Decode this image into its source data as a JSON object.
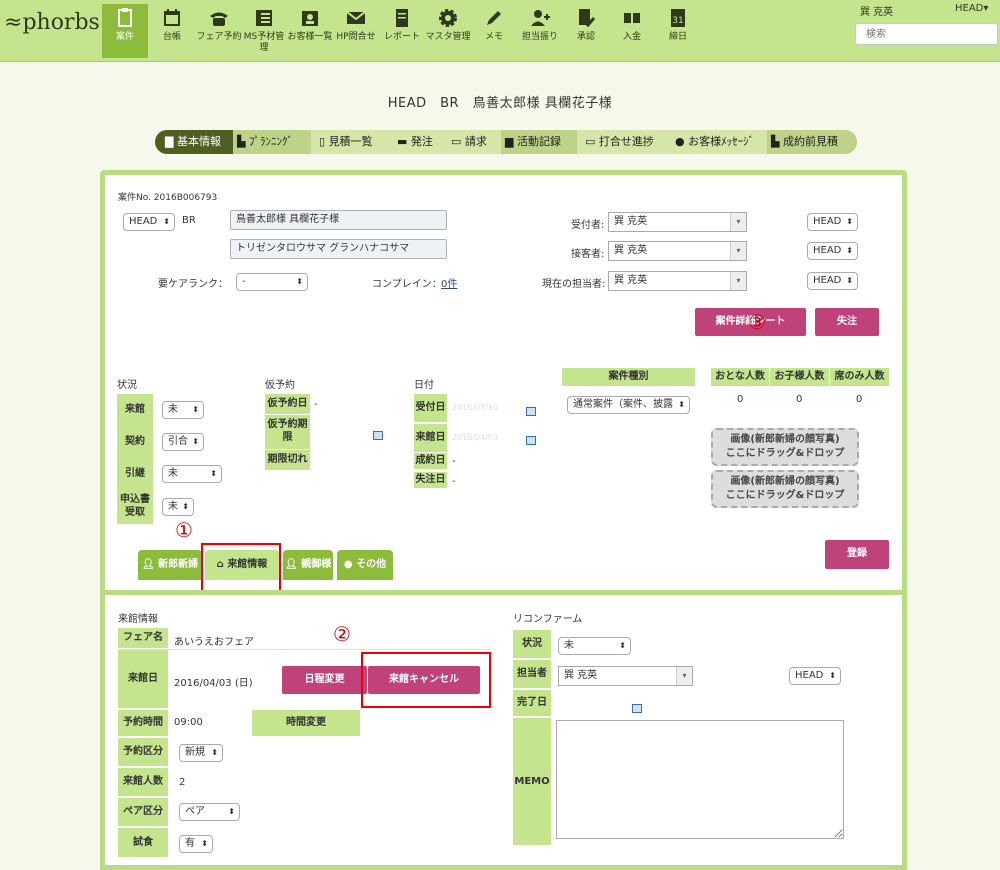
{
  "nav": {
    "logo": "phorbs",
    "items": [
      {
        "label": "案件",
        "icon": "clipboard-icon",
        "active": true
      },
      {
        "label": "台帳",
        "icon": "calendar-icon"
      },
      {
        "label": "フェア予約",
        "icon": "phone-icon"
      },
      {
        "label": "MS予材管理",
        "icon": "list-icon"
      },
      {
        "label": "お客様一覧",
        "icon": "id-card-icon"
      },
      {
        "label": "HP問合せ",
        "icon": "mail-icon"
      },
      {
        "label": "レポート",
        "icon": "document-icon"
      },
      {
        "label": "マスタ管理",
        "icon": "gear-icon"
      },
      {
        "label": "メモ",
        "icon": "pencil-icon"
      },
      {
        "label": "担当振り",
        "icon": "user-add-icon"
      },
      {
        "label": "承認",
        "icon": "check-doc-icon"
      },
      {
        "label": "入金",
        "icon": "money-icon"
      },
      {
        "label": "締日",
        "icon": "date-31-icon"
      }
    ],
    "user": "巽 克英",
    "branch": "HEAD▾",
    "search_placeholder": "検索"
  },
  "page_title": "HEAD　BR　鳥善太郎様 具欄花子様",
  "tabs": [
    "基本情報",
    "ﾌﾟﾗﾝﾆﾝｸﾞ",
    "見積一覧",
    "発注",
    "請求",
    "活動記録",
    "打合せ進捗",
    "お客様ﾒｯｾｰｼﾞ",
    "成約前見積"
  ],
  "case": {
    "case_no": "案件No. 2016B006793",
    "branch_select": "HEAD",
    "br": "BR",
    "names": "鳥善太郎様 具欄花子様",
    "kana": "トリゼンタロウサマ グランハナコサマ",
    "care_rank_label": "要ケアランク：",
    "care_rank_value": "-",
    "complaint_label": "コンプレイン：",
    "complaint_value": "0件",
    "receptionist_label": "受付者:",
    "receptionist_value": "巽 克英",
    "server_label": "接客者:",
    "server_value": "巽 克英",
    "current_label": "現在の担当者:",
    "current_value": "巽 克英",
    "branch1": "HEAD",
    "branch2": "HEAD",
    "branch3": "HEAD",
    "detail_sheet_button": "案件詳細シート",
    "lost_button": "失注"
  },
  "status": {
    "title": "状況",
    "rows": [
      {
        "label": "来館",
        "value": "未"
      },
      {
        "label": "契約",
        "value": "引合"
      },
      {
        "label": "引継",
        "value": "未"
      },
      {
        "label": "申込書受取",
        "value": "未"
      }
    ]
  },
  "provisional": {
    "title": "仮予約",
    "rows": [
      {
        "label": "仮予約日",
        "value": "-"
      },
      {
        "label": "仮予約期限",
        "value": ""
      },
      {
        "label": "期限切れ",
        "value": ""
      }
    ]
  },
  "dates": {
    "title": "日付",
    "rows": [
      {
        "label": "受付日",
        "value": "2016/03/10"
      },
      {
        "label": "来館日",
        "value": "2016/04/03"
      },
      {
        "label": "成約日",
        "value": "-"
      },
      {
        "label": "失注日",
        "value": "-"
      }
    ]
  },
  "case_type": {
    "header": "案件種別",
    "value": "通常案件（案件、披露"
  },
  "counts": {
    "headers": [
      "おとな人数",
      "お子様人数",
      "席のみ人数"
    ],
    "values": [
      "0",
      "0",
      "0"
    ]
  },
  "image_drop": {
    "line1": "画像(新郎新婦の顔写真)",
    "line2": "ここにドラッグ&ドロップ"
  },
  "register_button": "登録",
  "lower_tabs": [
    "新郎新婦",
    "来館情報",
    "親御様",
    "その他"
  ],
  "visit": {
    "title": "来館情報",
    "fair_label": "フェア名",
    "fair_value": "あいうえおフェア",
    "date_label": "来館日",
    "date_value": "2016/04/03 (日)",
    "reschedule_button": "日程変更",
    "cancel_button": "来館キャンセル",
    "time_label": "予約時間",
    "time_value": "09:00",
    "time_change_button": "時間変更",
    "kind_label": "予約区分",
    "kind_value": "新規",
    "people_label": "来館人数",
    "people_value": "2",
    "pair_label": "ペア区分",
    "pair_value": "ペア",
    "tasting_label": "試食",
    "tasting_value": "有"
  },
  "reconfirm": {
    "title": "リコンファーム",
    "status_label": "状況",
    "status_value": "未",
    "staff_label": "担当者",
    "staff_value": "巽 克英",
    "staff_branch": "HEAD",
    "done_label": "完了日",
    "memo_label": "MEMO"
  },
  "annotations": [
    "①",
    "②",
    "③"
  ]
}
